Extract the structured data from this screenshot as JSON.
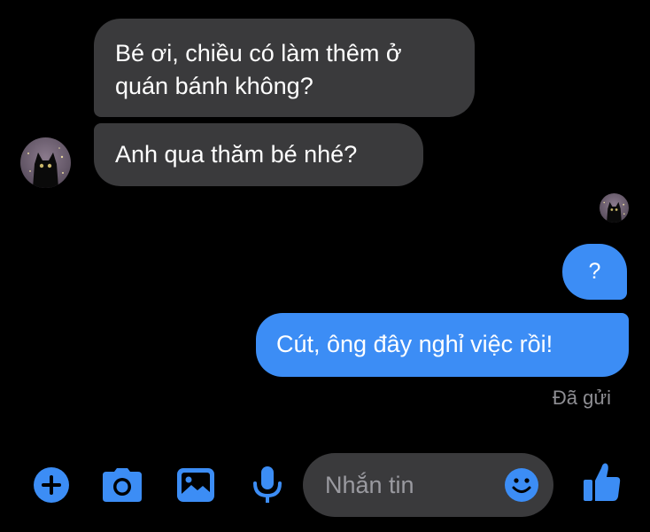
{
  "conversation": {
    "incoming": [
      {
        "text": "Bé ơi, chiều có làm thêm ở quán bánh không?"
      },
      {
        "text": "Anh qua thăm bé nhé?"
      }
    ],
    "outgoing": [
      {
        "text": "?"
      },
      {
        "text": "Cút, ông đây nghỉ việc rồi!"
      }
    ],
    "status": "Đã gửi"
  },
  "composer": {
    "placeholder": "Nhắn tin",
    "icons": [
      "plus-icon",
      "camera-icon",
      "image-icon",
      "microphone-icon",
      "emoji-icon",
      "thumbs-up-icon"
    ]
  },
  "colors": {
    "background": "#000000",
    "incoming_bubble": "#3a3a3c",
    "outgoing_bubble": "#3c8df5",
    "accent": "#3c8df5",
    "status_text": "#8e8e93"
  }
}
